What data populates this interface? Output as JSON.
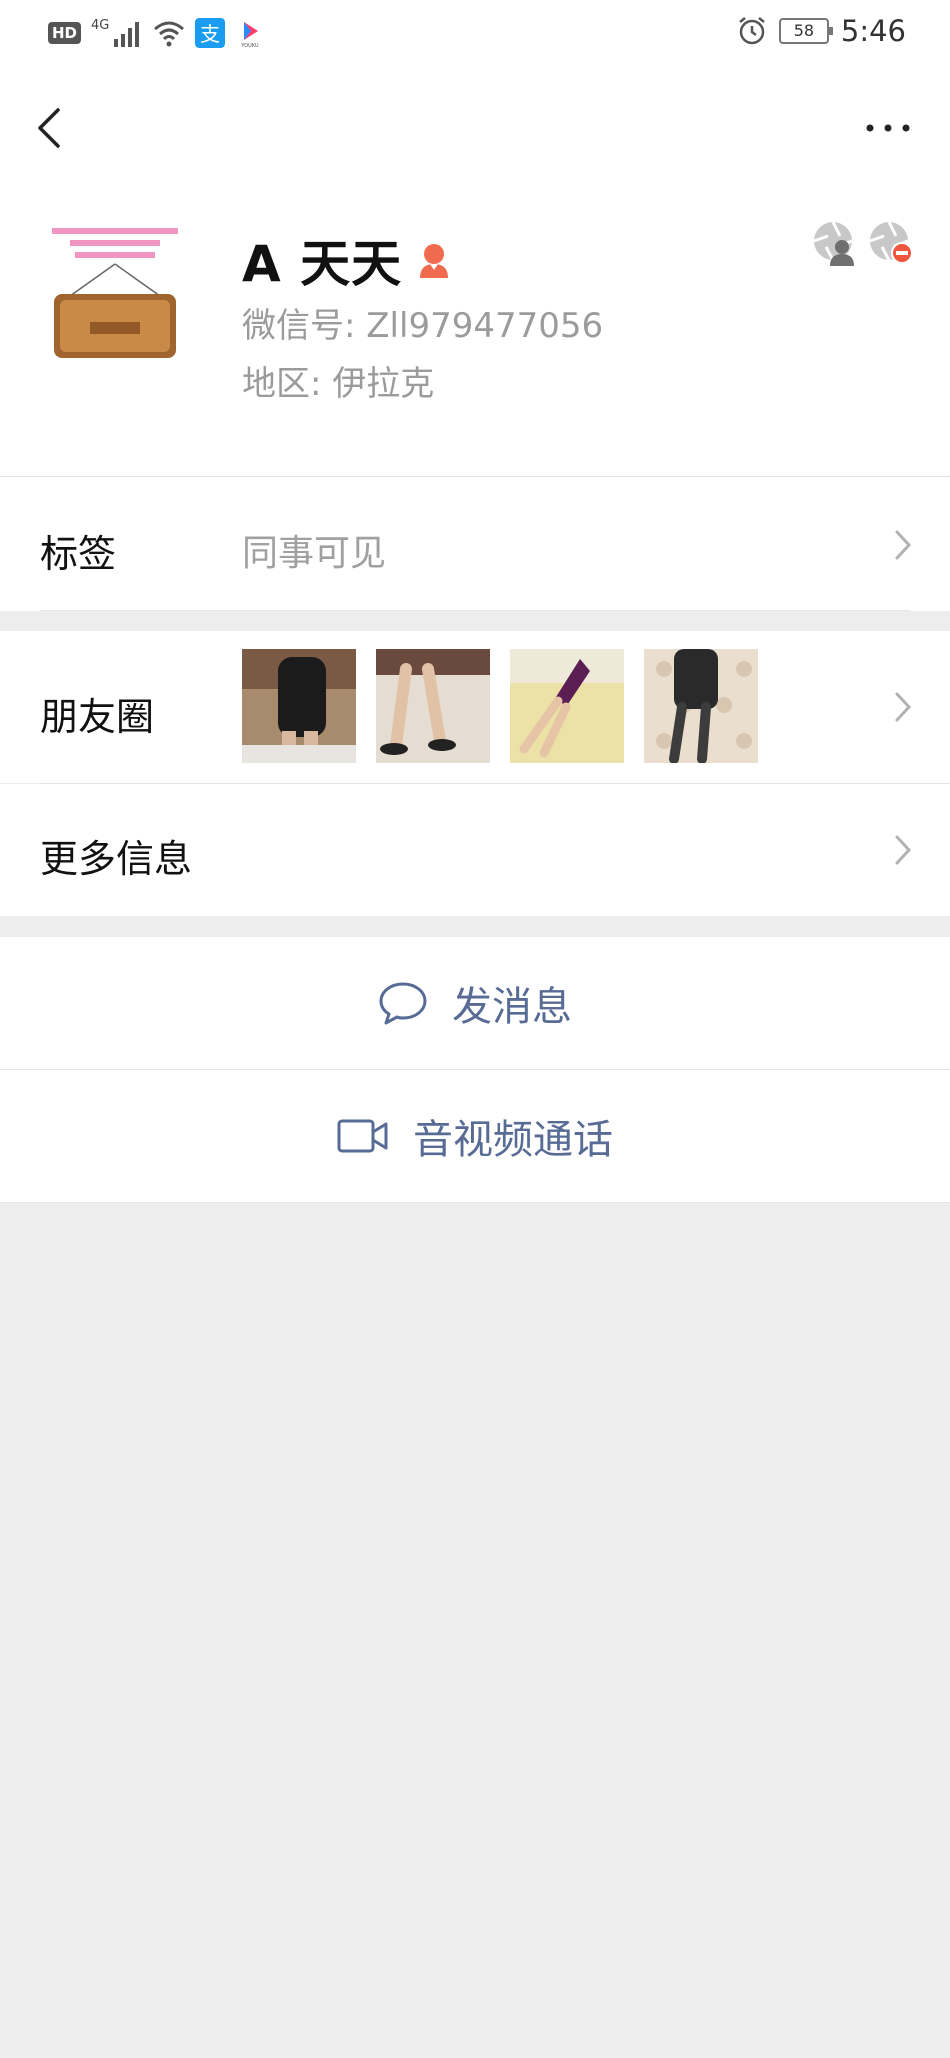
{
  "status_bar": {
    "hd": "HD",
    "network": "4G",
    "battery": "58",
    "time": "5:46",
    "icons": [
      "signal-icon",
      "wifi-icon",
      "alipay-icon",
      "youku-icon",
      "alarm-icon",
      "battery-icon"
    ]
  },
  "nav": {
    "back_icon": "chevron-left-icon",
    "more_icon": "more-dots-icon"
  },
  "profile": {
    "name": "A 天天",
    "wechat_id_label": "微信号: ",
    "wechat_id": "Zll979477056",
    "region_label": "地区: ",
    "region": "伊拉克",
    "gender_icon": "female-icon",
    "status_icons": [
      "moments-blocked-icon",
      "moments-hidden-icon"
    ]
  },
  "tags": {
    "label": "标签",
    "value": "同事可见"
  },
  "moments": {
    "label": "朋友圈",
    "thumbnail_count": 4
  },
  "more_info": {
    "label": "更多信息"
  },
  "actions": {
    "send_message": "发消息",
    "video_call": "音视频通话"
  },
  "colors": {
    "link_blue": "#576b95",
    "background": "#ededed",
    "secondary_text": "#9b9b9b",
    "female_icon": "#f06a50"
  }
}
